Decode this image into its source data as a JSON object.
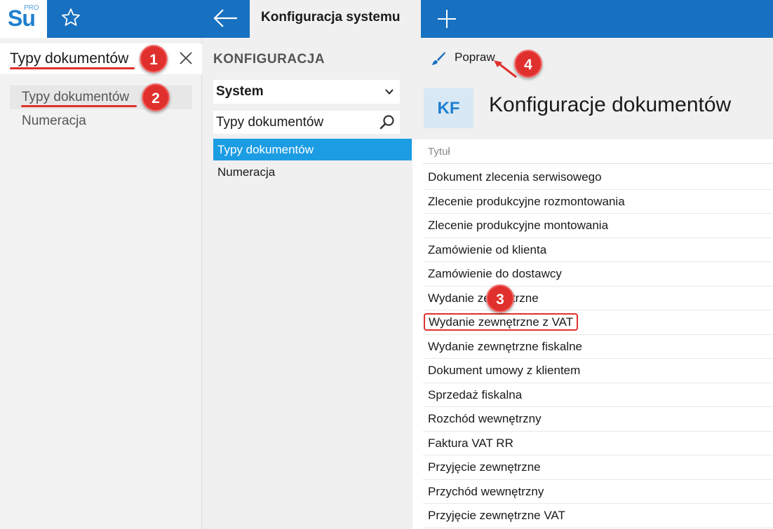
{
  "topbar": {
    "logo_text": "Su",
    "logo_badge": "PRO",
    "tab_title": "Konfiguracja systemu"
  },
  "left": {
    "search_value": "Typy dokumentów",
    "results": [
      "Typy dokumentów",
      "Numeracja"
    ]
  },
  "middle": {
    "title": "KONFIGURACJA",
    "select_value": "System",
    "search_value": "Typy dokumentów",
    "items": [
      "Typy dokumentów",
      "Numeracja"
    ]
  },
  "right": {
    "toolbar_action": "Popraw",
    "avatar_initials": "KF",
    "title": "Konfiguracje dokumentów",
    "column_header": "Tytuł",
    "rows": [
      "Dokument zlecenia serwisowego",
      "Zlecenie produkcyjne rozmontowania",
      "Zlecenie produkcyjne montowania",
      "Zamówienie od klienta",
      "Zamówienie do dostawcy",
      "Wydanie zewnętrzne",
      "Wydanie zewnętrzne z VAT",
      "Wydanie zewnętrzne fiskalne",
      "Dokument umowy z klientem",
      "Sprzedaż fiskalna",
      "Rozchód wewnętrzny",
      "Faktura VAT RR",
      "Przyjęcie zewnętrzne",
      "Przychód wewnętrzny",
      "Przyjęcie zewnętrzne VAT"
    ]
  },
  "callouts": [
    "1",
    "2",
    "3",
    "4"
  ],
  "colors": {
    "brand_blue": "#1771c0",
    "active_item": "#1c9ce3",
    "callout_red": "#e0302d"
  }
}
